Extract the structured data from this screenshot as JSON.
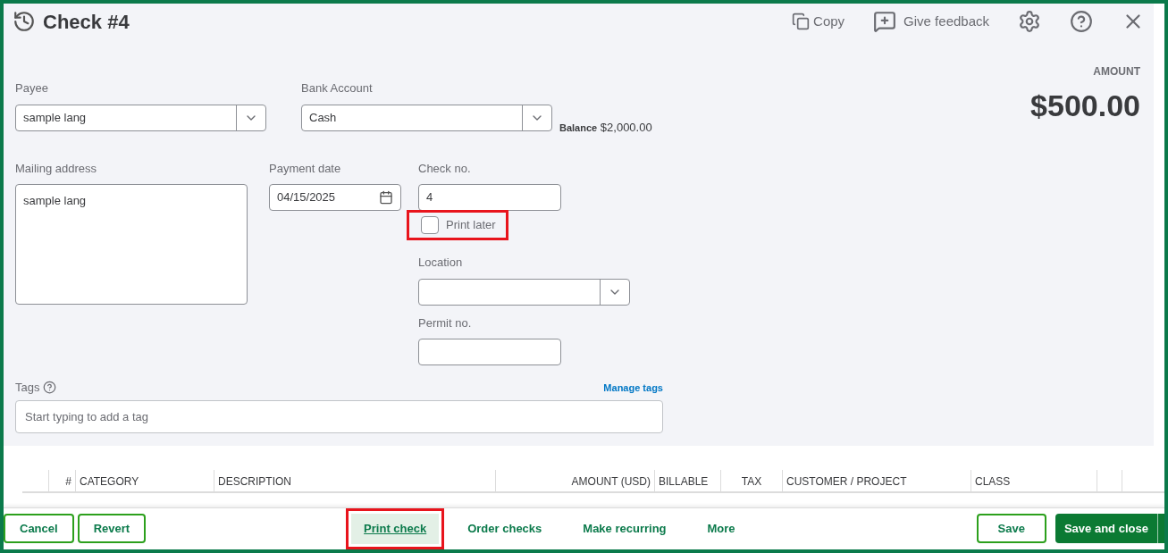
{
  "header": {
    "title": "Check #4",
    "actions": [
      "Copy",
      "Give feedback"
    ]
  },
  "amount": {
    "label": "AMOUNT",
    "value": "$500.00"
  },
  "payee": {
    "label": "Payee",
    "value": "sample lang"
  },
  "bank_account": {
    "label": "Bank Account",
    "value": "Cash",
    "balance_label": "Balance",
    "balance": "$2,000.00"
  },
  "mailing_address": {
    "label": "Mailing address",
    "value": "sample lang"
  },
  "payment_date": {
    "label": "Payment date",
    "value": "04/15/2025"
  },
  "check_no": {
    "label": "Check no.",
    "value": "4"
  },
  "print_later": {
    "label": "Print later",
    "checked": false,
    "highlighted": true
  },
  "location": {
    "label": "Location"
  },
  "permit_no": {
    "label": "Permit no."
  },
  "tags": {
    "label": "Tags",
    "link": "Manage tags",
    "placeholder": "Start typing to add a tag"
  },
  "table": {
    "columns": [
      "#",
      "CATEGORY",
      "DESCRIPTION",
      "AMOUNT (USD)",
      "BILLABLE",
      "TAX",
      "CUSTOMER / PROJECT",
      "CLASS"
    ]
  },
  "footer": {
    "left": [
      "Cancel",
      "Revert"
    ],
    "middle": [
      {
        "label": "Print check",
        "selected": true,
        "highlighted": true
      },
      {
        "label": "Order checks",
        "selected": false,
        "highlighted": false
      },
      {
        "label": "Make recurring",
        "selected": false,
        "highlighted": false
      },
      {
        "label": "More",
        "selected": false,
        "highlighted": false
      }
    ],
    "save": "Save",
    "save_close": "Save and close"
  }
}
